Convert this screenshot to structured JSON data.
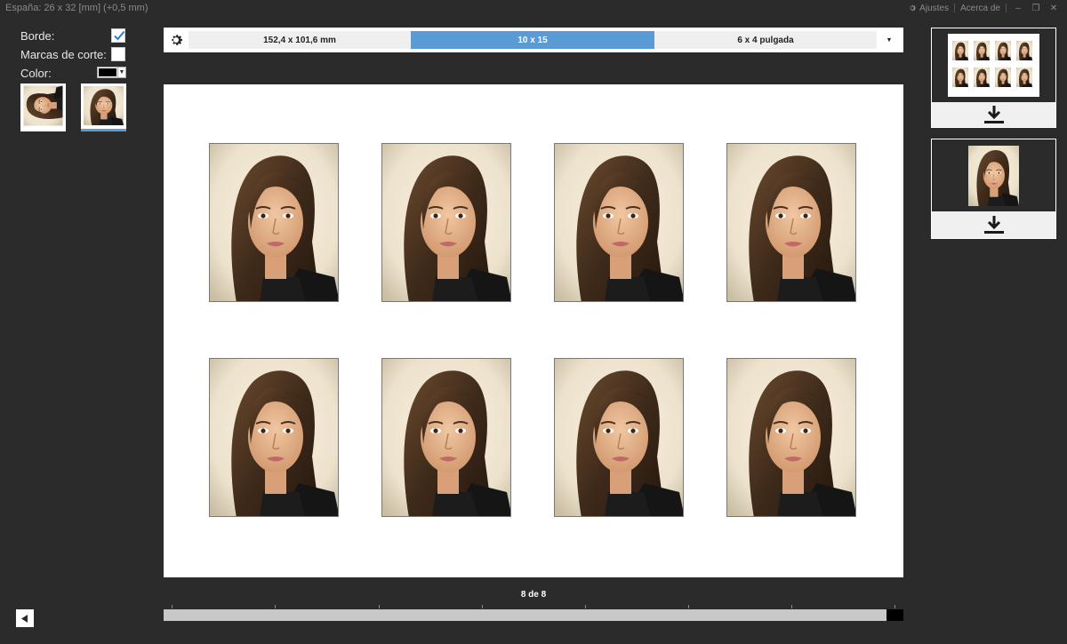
{
  "window": {
    "title": "España: 26 x 32 [mm] (+0,5 mm)",
    "settings_label": "Ajustes",
    "about_label": "Acerca de",
    "minimize_glyph": "–",
    "restore_glyph": "❐",
    "close_glyph": "✕"
  },
  "options": {
    "border_label": "Borde:",
    "border_checked": true,
    "cut_marks_label": "Marcas de corte:",
    "cut_marks_checked": false,
    "color_label": "Color:",
    "color_value": "#000000"
  },
  "format_selector": {
    "options": [
      "152,4 x 101,6 mm",
      "10 x 15",
      "6 x 4 pulgada"
    ],
    "selected_index": 1
  },
  "sheet": {
    "rows": 2,
    "columns": 4,
    "photo_count": 8
  },
  "pagination": {
    "label": "8 de 8",
    "position_fraction": 1.0
  },
  "colors": {
    "background": "#2b2b2b",
    "accent": "#5b9bd5",
    "sheet": "#ffffff"
  },
  "icons": {
    "settings": "gear-icon",
    "download": "download-icon",
    "back": "triangle-left-icon",
    "check": "check-icon",
    "dropdown": "chevron-down-icon"
  }
}
